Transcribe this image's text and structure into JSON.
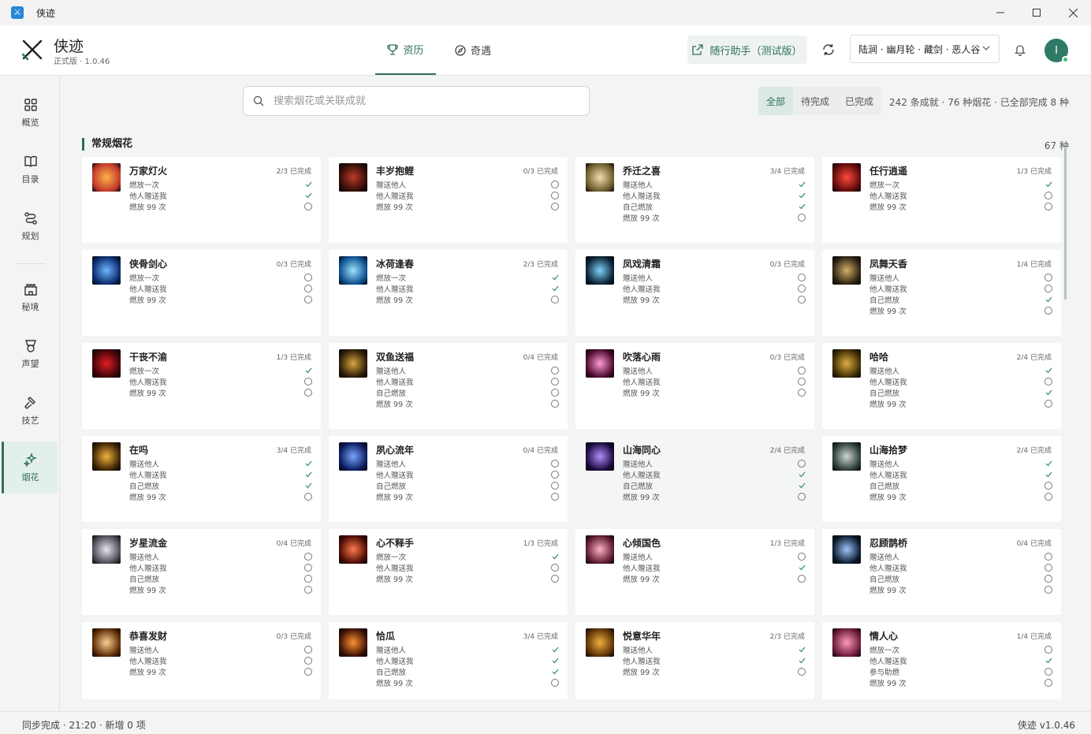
{
  "window": {
    "title": "侠迹"
  },
  "header": {
    "brand_name": "侠迹",
    "brand_version": "正式版 · 1.0.46",
    "tabs": [
      {
        "label": "资历",
        "active": true
      },
      {
        "label": "奇遇",
        "active": false
      }
    ],
    "assistant_label": "随行助手（测试版）",
    "server_label": "陆涧 · 幽月轮 · 藏剑 · 恶人谷",
    "avatar_letter": "I"
  },
  "sidebar": {
    "items": [
      {
        "label": "概览",
        "icon": "grid-icon"
      },
      {
        "label": "目录",
        "icon": "book-icon"
      },
      {
        "label": "规划",
        "icon": "route-icon"
      },
      {
        "label": "秘境",
        "icon": "castle-icon"
      },
      {
        "label": "声望",
        "icon": "badge-icon"
      },
      {
        "label": "技艺",
        "icon": "hammer-icon"
      },
      {
        "label": "烟花",
        "icon": "sparkle-icon",
        "active": true
      }
    ]
  },
  "toolbar": {
    "search_placeholder": "搜索烟花或关联成就",
    "filters": [
      {
        "label": "全部",
        "active": true
      },
      {
        "label": "待完成"
      },
      {
        "label": "已完成"
      }
    ],
    "summary": "242 条成就 · 76 种烟花 · 已全部完成 8 种"
  },
  "section": {
    "title": "常规烟花",
    "count": "67 种"
  },
  "colors": {
    "accent": "#2f6e5e",
    "check": "#2f8a6b"
  },
  "cards": [
    {
      "name": "万家灯火",
      "progress": "2/3 已完成",
      "rows": [
        [
          "燃放一次",
          true
        ],
        [
          "他人赠送我",
          true
        ],
        [
          "燃放 99 次",
          false
        ]
      ]
    },
    {
      "name": "丰岁抱鲤",
      "progress": "0/3 已完成",
      "rows": [
        [
          "赠送他人",
          false
        ],
        [
          "他人赠送我",
          false
        ],
        [
          "燃放 99 次",
          false
        ]
      ]
    },
    {
      "name": "乔迁之喜",
      "progress": "3/4 已完成",
      "rows": [
        [
          "赠送他人",
          true
        ],
        [
          "他人赠送我",
          true
        ],
        [
          "自己燃放",
          true
        ],
        [
          "燃放 99 次",
          false
        ]
      ]
    },
    {
      "name": "任行逍遥",
      "progress": "1/3 已完成",
      "rows": [
        [
          "燃放一次",
          true
        ],
        [
          "他人赠送我",
          false
        ],
        [
          "燃放 99 次",
          false
        ]
      ]
    },
    {
      "name": "侠骨剑心",
      "progress": "0/3 已完成",
      "rows": [
        [
          "燃放一次",
          false
        ],
        [
          "他人赠送我",
          false
        ],
        [
          "燃放 99 次",
          false
        ]
      ]
    },
    {
      "name": "冰荷逢春",
      "progress": "2/3 已完成",
      "rows": [
        [
          "燃放一次",
          true
        ],
        [
          "他人赠送我",
          true
        ],
        [
          "燃放 99 次",
          false
        ]
      ]
    },
    {
      "name": "凤戏清霜",
      "progress": "0/3 已完成",
      "rows": [
        [
          "赠送他人",
          false
        ],
        [
          "他人赠送我",
          false
        ],
        [
          "燃放 99 次",
          false
        ]
      ]
    },
    {
      "name": "凤舞天香",
      "progress": "1/4 已完成",
      "rows": [
        [
          "赠送他人",
          false
        ],
        [
          "他人赠送我",
          false
        ],
        [
          "自己燃放",
          true
        ],
        [
          "燃放 99 次",
          false
        ]
      ]
    },
    {
      "name": "干丧不渝",
      "progress": "1/3 已完成",
      "rows": [
        [
          "燃放一次",
          true
        ],
        [
          "他人赠送我",
          false
        ],
        [
          "燃放 99 次",
          false
        ]
      ]
    },
    {
      "name": "双鱼送福",
      "progress": "0/4 已完成",
      "rows": [
        [
          "赠送他人",
          false
        ],
        [
          "他人赠送我",
          false
        ],
        [
          "自己燃放",
          false
        ],
        [
          "燃放 99 次",
          false
        ]
      ]
    },
    {
      "name": "吹落心雨",
      "progress": "0/3 已完成",
      "rows": [
        [
          "赠送他人",
          false
        ],
        [
          "他人赠送我",
          false
        ],
        [
          "燃放 99 次",
          false
        ]
      ]
    },
    {
      "name": "哈哈",
      "progress": "2/4 已完成",
      "rows": [
        [
          "赠送他人",
          true
        ],
        [
          "他人赠送我",
          false
        ],
        [
          "自己燃放",
          true
        ],
        [
          "燃放 99 次",
          false
        ]
      ]
    },
    {
      "name": "在吗",
      "progress": "3/4 已完成",
      "rows": [
        [
          "赠送他人",
          true
        ],
        [
          "他人赠送我",
          true
        ],
        [
          "自己燃放",
          true
        ],
        [
          "燃放 99 次",
          false
        ]
      ]
    },
    {
      "name": "夙心流年",
      "progress": "0/4 已完成",
      "rows": [
        [
          "赠送他人",
          false
        ],
        [
          "他人赠送我",
          false
        ],
        [
          "自己燃放",
          false
        ],
        [
          "燃放 99 次",
          false
        ]
      ]
    },
    {
      "name": "山海同心",
      "progress": "2/4 已完成",
      "hl": true,
      "rows": [
        [
          "赠送他人",
          false
        ],
        [
          "他人赠送我",
          true
        ],
        [
          "自己燃放",
          true
        ],
        [
          "燃放 99 次",
          false
        ]
      ]
    },
    {
      "name": "山海拾梦",
      "progress": "2/4 已完成",
      "rows": [
        [
          "赠送他人",
          true
        ],
        [
          "他人赠送我",
          true
        ],
        [
          "自己燃放",
          false
        ],
        [
          "燃放 99 次",
          false
        ]
      ]
    },
    {
      "name": "岁星流金",
      "progress": "0/4 已完成",
      "rows": [
        [
          "赠送他人",
          false
        ],
        [
          "他人赠送我",
          false
        ],
        [
          "自己燃放",
          false
        ],
        [
          "燃放 99 次",
          false
        ]
      ]
    },
    {
      "name": "心不释手",
      "progress": "1/3 已完成",
      "rows": [
        [
          "燃放一次",
          true
        ],
        [
          "他人赠送我",
          false
        ],
        [
          "燃放 99 次",
          false
        ]
      ]
    },
    {
      "name": "心倾国色",
      "progress": "1/3 已完成",
      "rows": [
        [
          "赠送他人",
          false
        ],
        [
          "他人赠送我",
          true
        ],
        [
          "燃放 99 次",
          false
        ]
      ]
    },
    {
      "name": "忍顾鹊桥",
      "progress": "0/4 已完成",
      "rows": [
        [
          "赠送他人",
          false
        ],
        [
          "他人赠送我",
          false
        ],
        [
          "自己燃放",
          false
        ],
        [
          "燃放 99 次",
          false
        ]
      ]
    },
    {
      "name": "恭喜发财",
      "progress": "0/3 已完成",
      "rows": [
        [
          "赠送他人",
          false
        ],
        [
          "他人赠送我",
          false
        ],
        [
          "燃放 99 次",
          false
        ]
      ]
    },
    {
      "name": "恰瓜",
      "progress": "3/4 已完成",
      "rows": [
        [
          "赠送他人",
          true
        ],
        [
          "他人赠送我",
          true
        ],
        [
          "自己燃放",
          true
        ],
        [
          "燃放 99 次",
          false
        ]
      ]
    },
    {
      "name": "悦意华年",
      "progress": "2/3 已完成",
      "rows": [
        [
          "赠送他人",
          true
        ],
        [
          "他人赠送我",
          true
        ],
        [
          "燃放 99 次",
          false
        ]
      ]
    },
    {
      "name": "情人心",
      "progress": "1/4 已完成",
      "rows": [
        [
          "燃放一次",
          false
        ],
        [
          "他人赠送我",
          true
        ],
        [
          "参与助燃",
          false
        ],
        [
          "燃放 99 次",
          false
        ]
      ]
    }
  ],
  "status": {
    "left": "同步完成 · 21:20 · 新增 0 项",
    "right": "侠迹 v1.0.46"
  }
}
